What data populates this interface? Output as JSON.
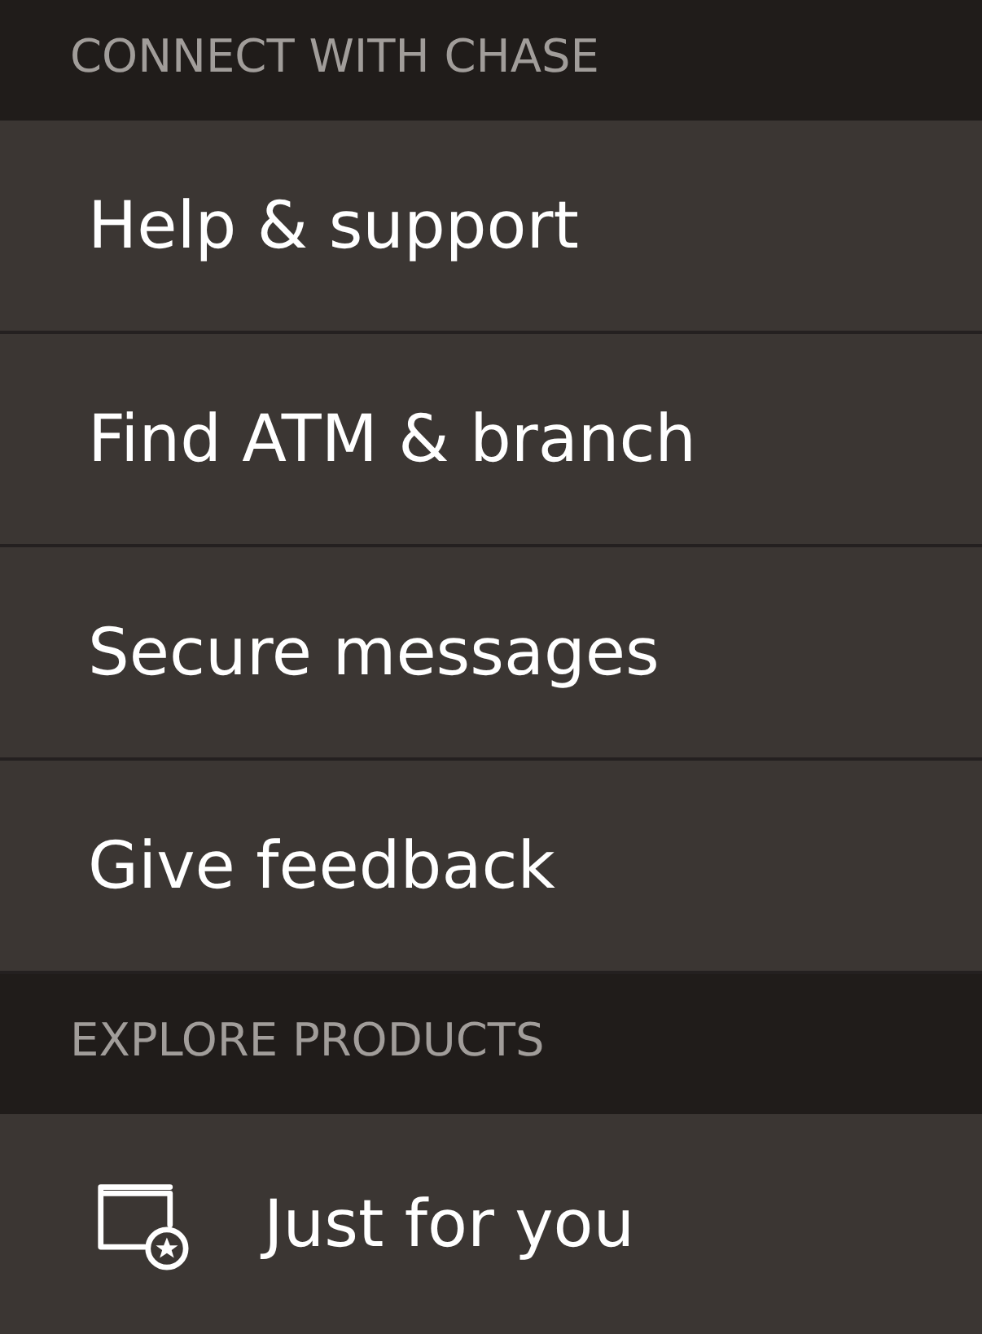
{
  "sections": [
    {
      "heading": "CONNECT WITH CHASE",
      "items": [
        {
          "label": "Help & support",
          "kind": "text"
        },
        {
          "label": "Find ATM & branch",
          "kind": "text"
        },
        {
          "label": "Secure messages",
          "kind": "text"
        },
        {
          "label": "Give feedback",
          "kind": "text"
        }
      ]
    },
    {
      "heading": "EXPLORE PRODUCTS",
      "items": [
        {
          "label": "Just for you",
          "kind": "icon"
        }
      ]
    }
  ]
}
